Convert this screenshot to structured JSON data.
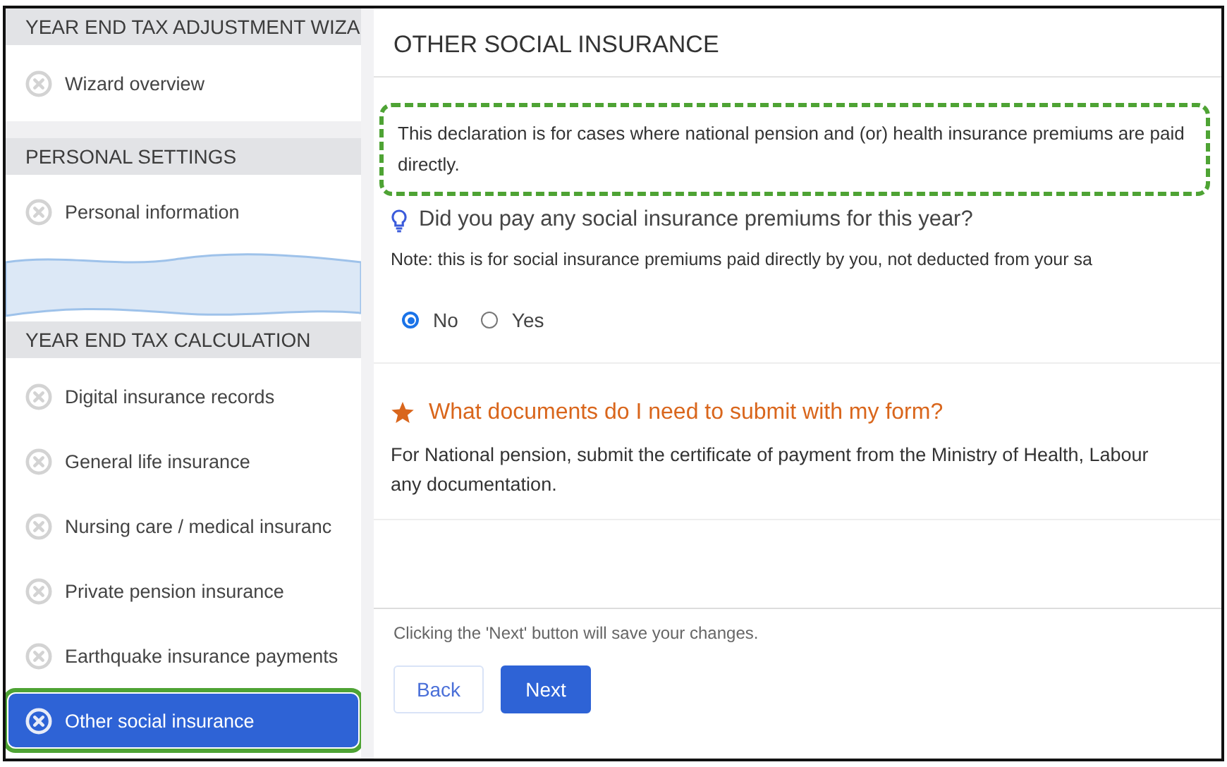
{
  "sidebar": {
    "sections": [
      {
        "kind": "section",
        "title": "YEAR END TAX ADJUSTMENT WIZA",
        "items": [
          {
            "label": "Wizard overview",
            "selected": false
          }
        ]
      },
      {
        "kind": "section",
        "title": "PERSONAL SETTINGS",
        "items": [
          {
            "label": "Personal information",
            "selected": false
          }
        ]
      },
      {
        "kind": "torn"
      },
      {
        "kind": "section",
        "title": "YEAR END TAX CALCULATION",
        "items": [
          {
            "label": "Digital insurance records",
            "selected": false
          },
          {
            "label": "General life insurance",
            "selected": false
          },
          {
            "label": "Nursing care / medical insuranc",
            "selected": false
          },
          {
            "label": "Private pension insurance",
            "selected": false
          },
          {
            "label": "Earthquake insurance payments",
            "selected": false
          },
          {
            "label": "Other social insurance",
            "selected": true
          }
        ]
      }
    ]
  },
  "page": {
    "title": "OTHER SOCIAL INSURANCE",
    "declaration": "This declaration is for cases where national pension and (or) health insurance premiums are paid directly.",
    "question": "Did you pay any social insurance premiums for this year?",
    "note": "Note: this is for social insurance premiums paid directly by you, not deducted from your sa",
    "options": [
      {
        "label": "No",
        "selected": true
      },
      {
        "label": "Yes",
        "selected": false
      }
    ],
    "help_title": "What documents do I need to submit with my form?",
    "help_lines": [
      "For National pension, submit the certificate of payment from the Ministry of Health, Labour",
      "any documentation."
    ],
    "footer_note": "Clicking the 'Next' button will save your changes.",
    "buttons": [
      {
        "label": "Back",
        "kind": "secondary"
      },
      {
        "label": "Next",
        "kind": "primary"
      }
    ]
  }
}
